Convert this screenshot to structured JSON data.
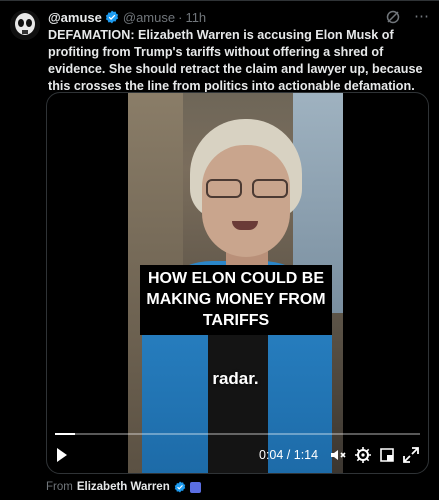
{
  "tweet": {
    "name": "@amuse",
    "handle": "@amuse",
    "separator": "·",
    "time": "11h",
    "text": "DEFAMATION: Elizabeth Warren is accusing Elon Musk of profiting from Trump's tariffs without offering a shred of evidence. She should retract the claim and lawyer up, because this crosses the line from politics into actionable defamation."
  },
  "video": {
    "caption": "HOW ELON COULD BE MAKING MONEY FROM TARIFFS",
    "subtitle": "radar.",
    "time_readout": "0:04 / 1:14",
    "progress": 0.054
  },
  "attribution": {
    "prefix": "From",
    "source": "Elizabeth Warren"
  },
  "colors": {
    "background": "#000000",
    "verified": "#1d9bf0",
    "muted": "#71767b"
  },
  "icons": [
    "grok-icon",
    "more-icon",
    "play-icon",
    "mute-icon",
    "settings-icon",
    "pip-icon",
    "fullscreen-icon"
  ]
}
